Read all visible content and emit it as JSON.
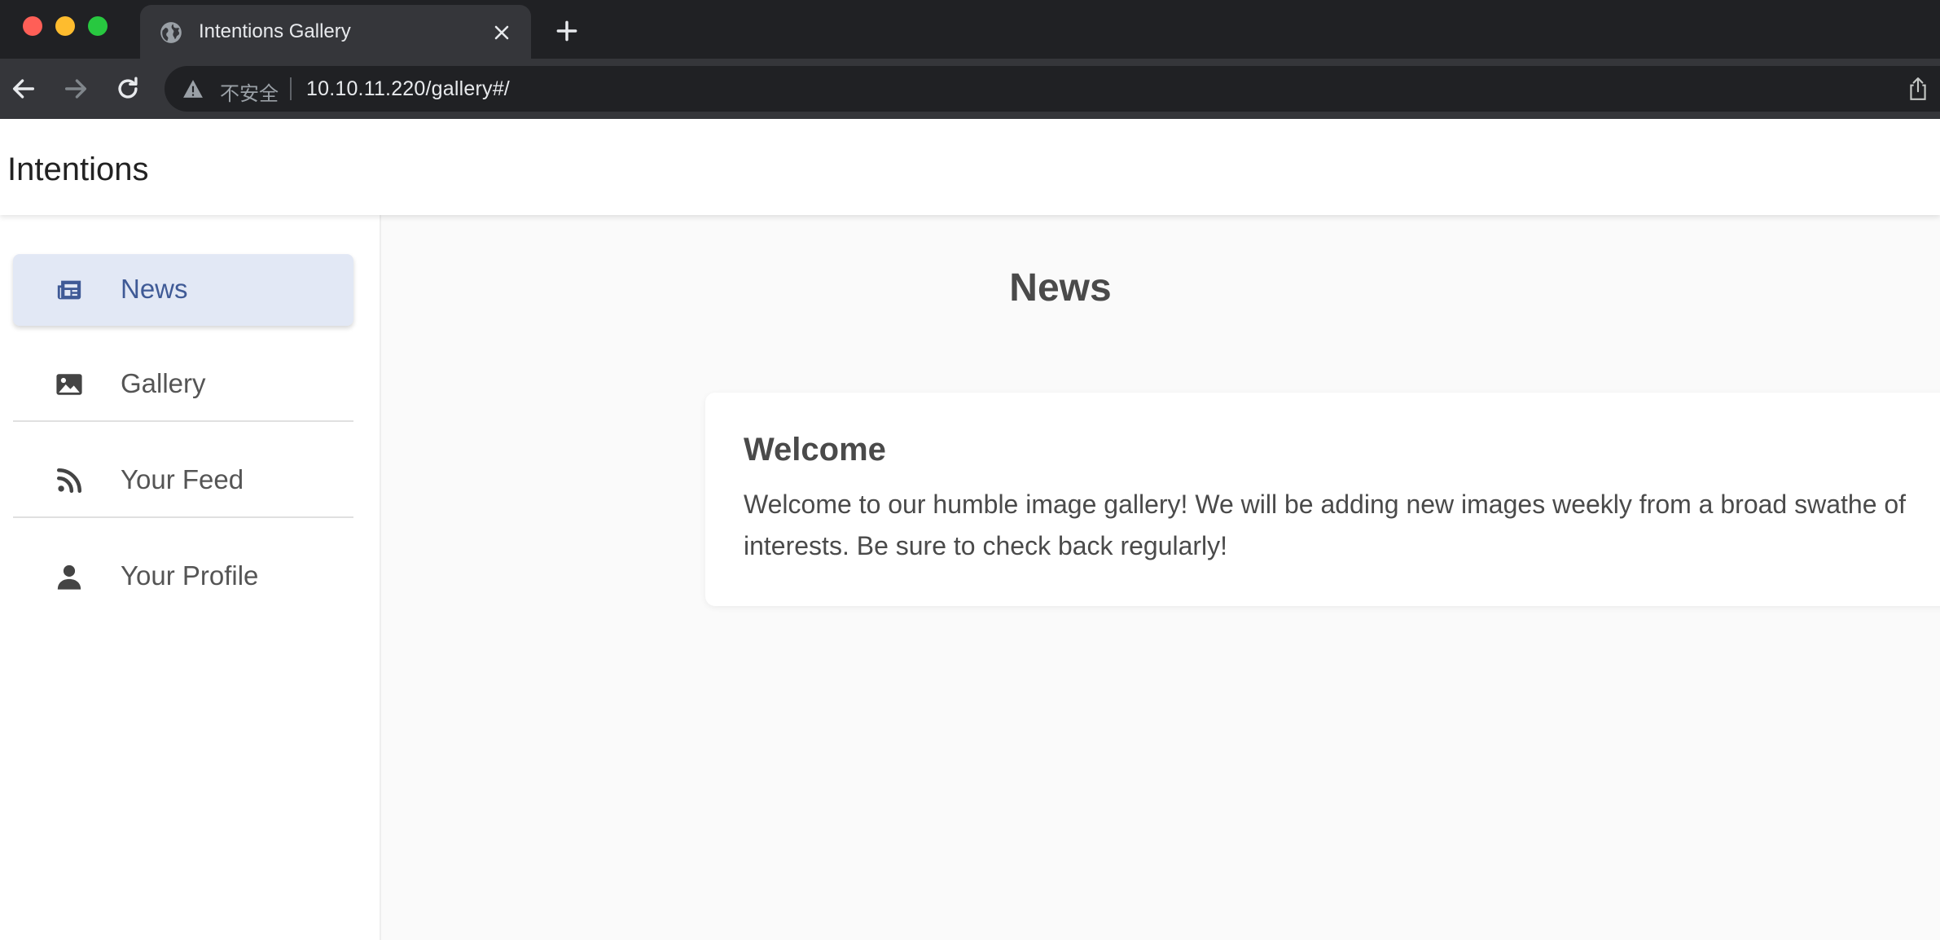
{
  "browser": {
    "tab": {
      "title": "Intentions Gallery",
      "icon": "globe-icon"
    },
    "address_bar": {
      "security_label": "不安全",
      "url": "10.10.11.220/gallery#/"
    }
  },
  "app": {
    "title": "Intentions"
  },
  "sidebar": {
    "items": [
      {
        "label": "News",
        "icon": "newspaper-icon",
        "active": true
      },
      {
        "label": "Gallery",
        "icon": "image-icon",
        "active": false
      },
      {
        "label": "Your Feed",
        "icon": "rss-icon",
        "active": false
      },
      {
        "label": "Your Profile",
        "icon": "user-icon",
        "active": false
      }
    ]
  },
  "main": {
    "heading": "News",
    "posts": [
      {
        "title": "Welcome",
        "body": "Welcome to our humble image gallery! We will be adding new images weekly from a broad swathe of interests. Be sure to check back regularly!"
      }
    ]
  },
  "colors": {
    "active_nav_bg": "#e2e8f5",
    "active_nav_text": "#3f5a96",
    "browser_dark": "#202124",
    "browser_toolbar": "#35363a"
  }
}
